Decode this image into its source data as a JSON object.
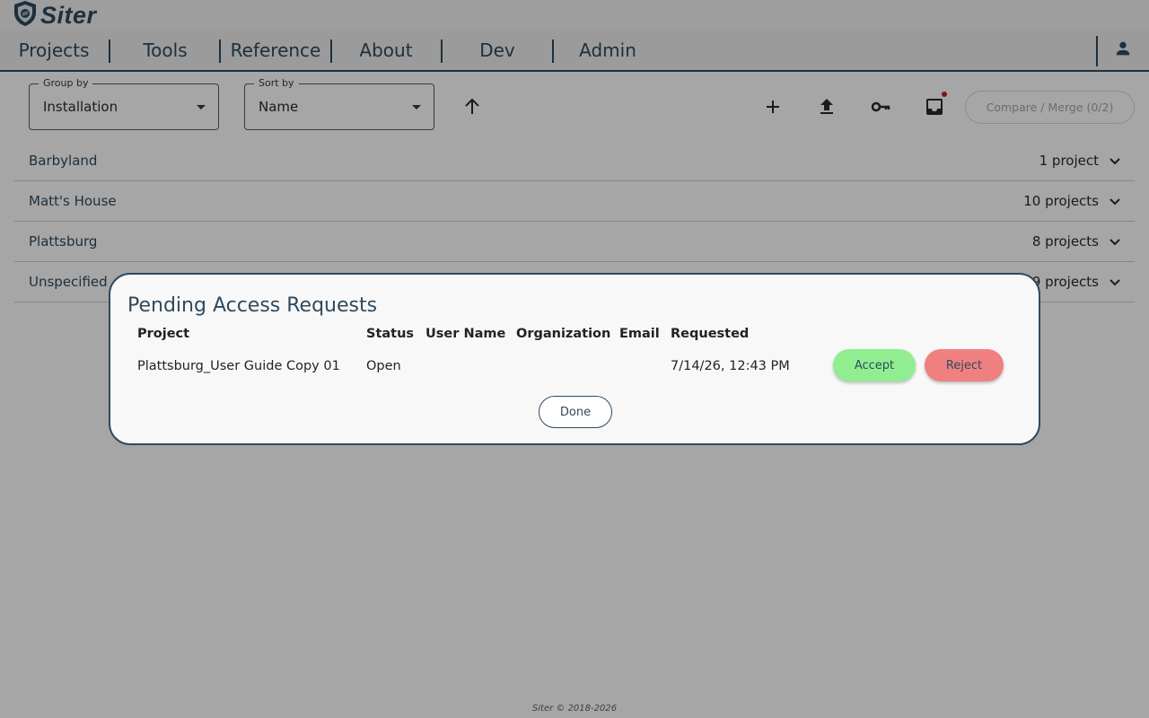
{
  "app": {
    "name": "Siter",
    "footer": "Siter © 2018-2026"
  },
  "nav": {
    "items": [
      "Projects",
      "Tools",
      "Reference",
      "About",
      "Dev",
      "Admin"
    ]
  },
  "toolbar": {
    "group_by": {
      "label": "Group by",
      "value": "Installation"
    },
    "sort_by": {
      "label": "Sort by",
      "value": "Name"
    },
    "compare_label": "Compare / Merge (0/2)",
    "icons": [
      "arrow-up-icon",
      "plus-icon",
      "upload-icon",
      "key-icon",
      "inbox-icon"
    ]
  },
  "groups": [
    {
      "name": "Barbyland",
      "count": "1 project"
    },
    {
      "name": "Matt's House",
      "count": "10 projects"
    },
    {
      "name": "Plattsburg",
      "count": "8 projects"
    },
    {
      "name": "Unspecified",
      "count": "9 projects"
    }
  ],
  "dialog": {
    "title": "Pending Access Requests",
    "columns": [
      "Project",
      "Status",
      "User Name",
      "Organization",
      "Email",
      "Requested"
    ],
    "rows": [
      {
        "project": "Plattsburg_User Guide Copy 01",
        "status": "Open",
        "user_name": "",
        "organization": "",
        "email": "",
        "requested": "7/14/26, 12:43 PM"
      }
    ],
    "accept_label": "Accept",
    "reject_label": "Reject",
    "done_label": "Done"
  },
  "colors": {
    "brand": "#2f4a5e",
    "accept": "#90ee90",
    "reject": "#f08080",
    "notification": "#d01c1c"
  }
}
